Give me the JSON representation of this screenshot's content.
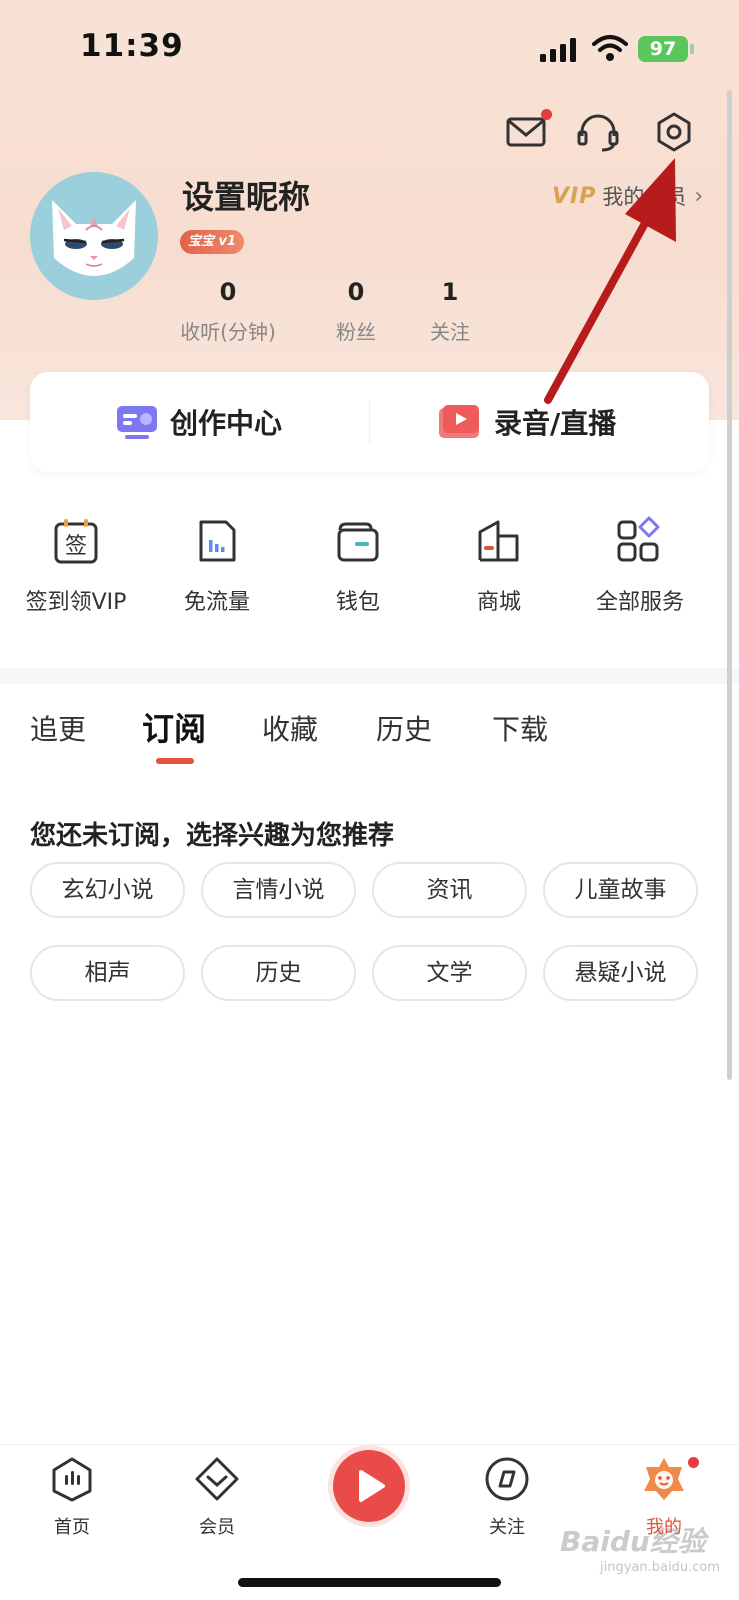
{
  "status_bar": {
    "time": "11:39",
    "battery": "97"
  },
  "top_icons": [
    "mail-icon",
    "headset-icon",
    "settings-icon"
  ],
  "profile": {
    "nickname": "设置昵称",
    "level_badge": "宝宝 v1",
    "vip_logo": "VIP",
    "vip_label": "我的会员",
    "stats": [
      {
        "value": "0",
        "label": "收听(分钟)"
      },
      {
        "value": "0",
        "label": "粉丝"
      },
      {
        "value": "1",
        "label": "关注"
      }
    ]
  },
  "creator_card": {
    "left_label": "创作中心",
    "right_label": "录音/直播"
  },
  "services": [
    {
      "label": "签到领VIP",
      "icon": "sign-in-icon",
      "icon_text": "签"
    },
    {
      "label": "免流量",
      "icon": "data-free-icon"
    },
    {
      "label": "钱包",
      "icon": "wallet-icon"
    },
    {
      "label": "商城",
      "icon": "store-icon"
    },
    {
      "label": "全部服务",
      "icon": "all-services-icon"
    }
  ],
  "tabs": [
    {
      "label": "追更",
      "active": false
    },
    {
      "label": "订阅",
      "active": true
    },
    {
      "label": "收藏",
      "active": false
    },
    {
      "label": "历史",
      "active": false
    },
    {
      "label": "下载",
      "active": false
    }
  ],
  "prompt": "您还未订阅，选择兴趣为您推荐",
  "interest_chips": [
    "玄幻小说",
    "言情小说",
    "资讯",
    "儿童故事",
    "相声",
    "历史",
    "文学",
    "悬疑小说"
  ],
  "bottom_nav": [
    {
      "label": "首页",
      "icon": "home-icon",
      "active": false
    },
    {
      "label": "会员",
      "icon": "vip-icon",
      "active": false
    },
    {
      "label": "关注",
      "icon": "follow-icon",
      "active": false
    },
    {
      "label": "我的",
      "icon": "me-icon",
      "active": true
    }
  ],
  "watermark": {
    "text": "Baidu经验",
    "sub": "jingyan.baidu.com"
  },
  "colors": {
    "accent": "#e4513a",
    "vip_gold": "#d7a24e",
    "annotation_arrow": "#b71c1c"
  }
}
